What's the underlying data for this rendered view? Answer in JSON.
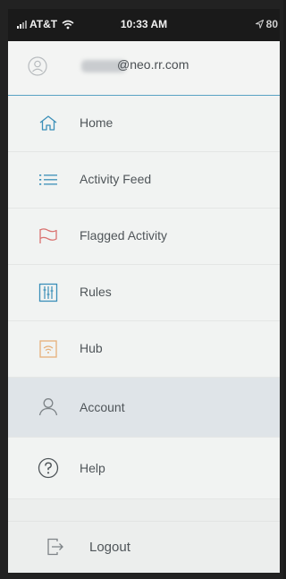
{
  "status_bar": {
    "carrier": "AT&T",
    "time": "10:33 AM",
    "battery": "80"
  },
  "user": {
    "email_suffix": "@neo.rr.com"
  },
  "menu": {
    "items": [
      {
        "label": "Home",
        "icon": "home-icon"
      },
      {
        "label": "Activity Feed",
        "icon": "list-icon"
      },
      {
        "label": "Flagged Activity",
        "icon": "flag-icon"
      },
      {
        "label": "Rules",
        "icon": "sliders-icon"
      },
      {
        "label": "Hub",
        "icon": "hub-wifi-icon"
      },
      {
        "label": "Account",
        "icon": "user-icon",
        "active": true
      },
      {
        "label": "Help",
        "icon": "help-icon"
      },
      {
        "label": "Logout",
        "icon": "logout-icon"
      }
    ]
  },
  "colors": {
    "accent_blue": "#3b8fb8",
    "flag_red": "#d9716f",
    "hub_orange": "#e6b07a",
    "active_bg": "#dfe4e8"
  }
}
